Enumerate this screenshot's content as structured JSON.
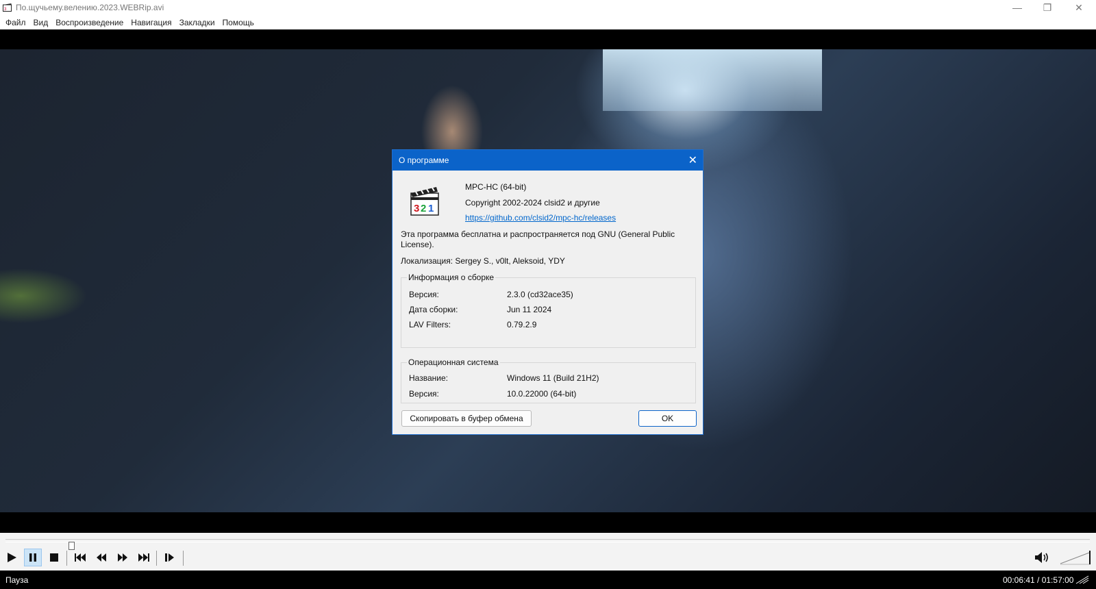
{
  "window": {
    "title": "По.щучьему.велению.2023.WEBRip.avi",
    "minimize_icon": "minimize-icon",
    "restore_icon": "restore-icon",
    "close_icon": "close-icon"
  },
  "menu": [
    "Файл",
    "Вид",
    "Воспроизведение",
    "Навигация",
    "Закладки",
    "Помощь"
  ],
  "dialog": {
    "title": "О программе",
    "app_name": "MPC-HC (64-bit)",
    "copyright": "Copyright 2002-2024 clsid2 и другие",
    "link": "https://github.com/clsid2/mpc-hc/releases",
    "license_text": "Эта программа бесплатна и распространяется под GNU (General Public License).",
    "localization": "Локализация: Sergey S., v0lt, Aleksoid, YDY",
    "build_info": {
      "label": "Информация о сборке",
      "rows": [
        {
          "key": "Версия:",
          "value": "2.3.0 (cd32ace35)"
        },
        {
          "key": "Дата сборки:",
          "value": "Jun 11 2024"
        },
        {
          "key": "LAV Filters:",
          "value": "0.79.2.9"
        }
      ]
    },
    "os_info": {
      "label": "Операционная система",
      "rows": [
        {
          "key": "Название:",
          "value": "Windows 11 (Build 21H2)"
        },
        {
          "key": "Версия:",
          "value": "10.0.22000 (64-bit)"
        }
      ]
    },
    "copy_button": "Скопировать в буфер обмена",
    "ok_button": "OK"
  },
  "playback": {
    "seek_fraction": 0.057,
    "volume_fraction": 1.0
  },
  "status": {
    "state": "Пауза",
    "time": "00:06:41 / 01:57:00"
  },
  "colors": {
    "dialog_title_bg": "#0b63c9",
    "link": "#0066cc",
    "controls_bg": "#f3f3f3"
  }
}
